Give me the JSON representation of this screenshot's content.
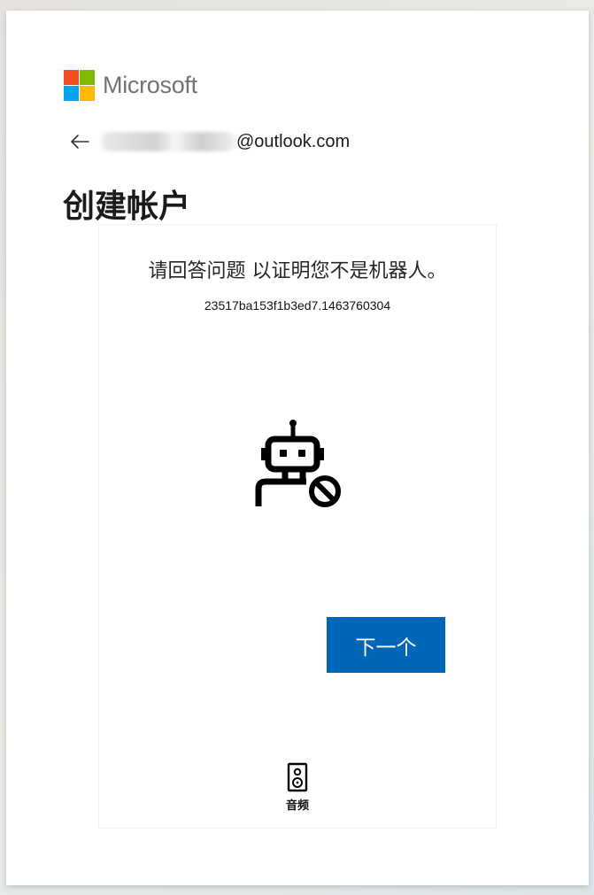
{
  "brand": {
    "name": "Microsoft",
    "logo_colors": [
      "#f25022",
      "#7fba00",
      "#00a4ef",
      "#ffb900"
    ],
    "text_color": "#737373"
  },
  "account": {
    "email_domain": "@outlook.com",
    "back_icon": "back-arrow-icon"
  },
  "page": {
    "title": "创建帐户"
  },
  "challenge": {
    "question": "请回答问题 以证明您不是机器人。",
    "id": "23517ba153f1b3ed7.1463760304",
    "illustration_icon": "robot-blocked-icon",
    "next_button": "下一个",
    "next_button_color": "#0067b8",
    "audio_icon": "speaker-icon",
    "audio_label": "音频"
  }
}
